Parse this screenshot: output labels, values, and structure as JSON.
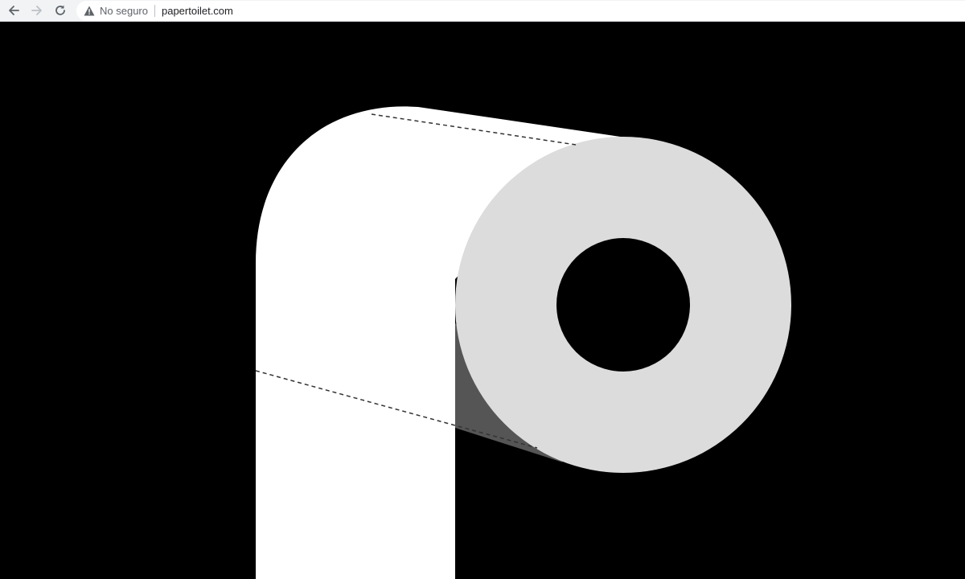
{
  "browser": {
    "security_label": "No seguro",
    "url": "papertoilet.com"
  },
  "icons": {
    "back": "arrow-left-icon",
    "forward": "arrow-right-icon",
    "reload": "reload-icon",
    "security": "warning-triangle-icon"
  },
  "colors": {
    "page_background": "#000000",
    "paper": "#ffffff",
    "roll_end": "#dcdcdc",
    "roll_shadow": "#555555",
    "toolbar": "#f1f3f4"
  }
}
